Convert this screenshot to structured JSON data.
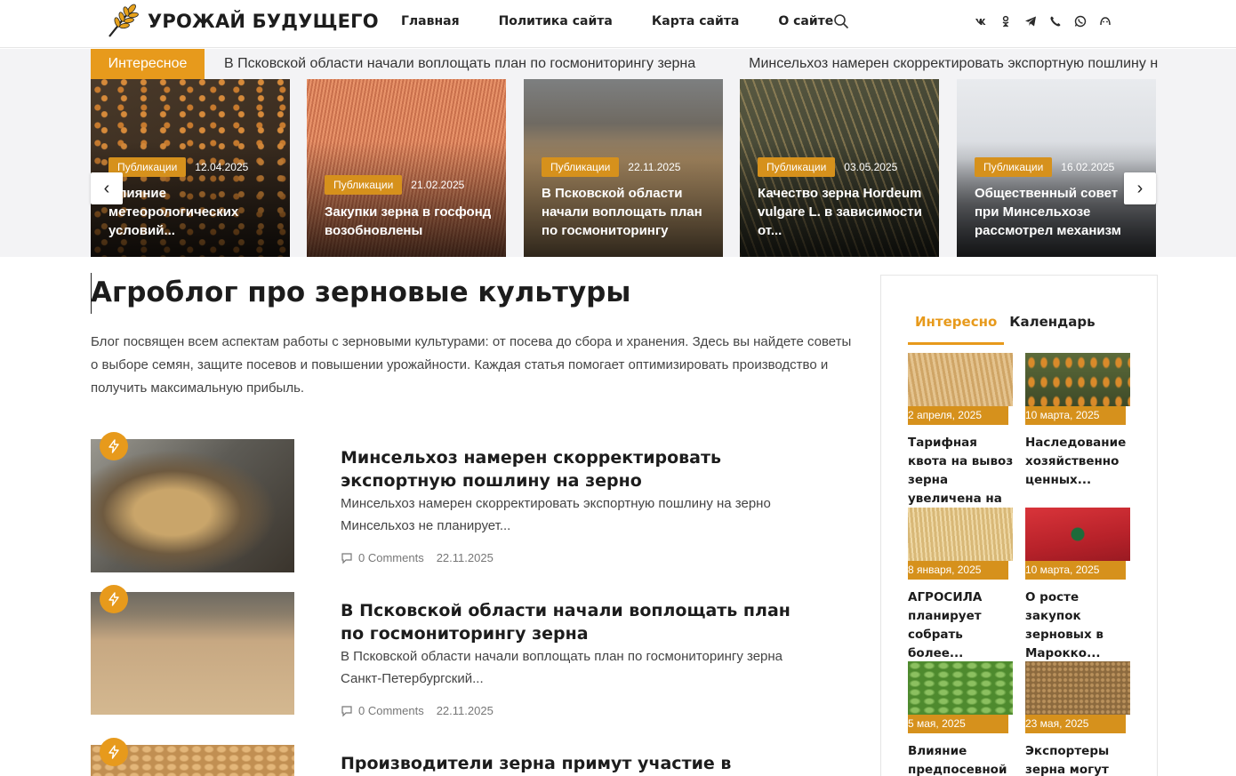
{
  "header": {
    "logo_text": "УРОЖАЙ БУДУЩЕГО",
    "nav": [
      "Главная",
      "Политика сайта",
      "Карта сайта",
      "О сайте"
    ],
    "socials": [
      "vk-icon",
      "odnoklassniki-icon",
      "telegram-icon",
      "viber-icon",
      "whatsapp-icon",
      "max-icon"
    ]
  },
  "ticker": {
    "label": "Интересное",
    "items": [
      "В Псковской области начали воплощать план по госмониторингу зерна",
      "Минсельхоз намерен скорректировать экспортную пошлину на зерно"
    ]
  },
  "featured": [
    {
      "category": "Публикации",
      "date": "12.04.2025",
      "title": "Влияние метеорологических условий..."
    },
    {
      "category": "Публикации",
      "date": "21.02.2025",
      "title": "Закупки зерна в госфонд возобновлены"
    },
    {
      "category": "Публикации",
      "date": "22.11.2025",
      "title": "В Псковской области начали воплощать план по госмониторингу"
    },
    {
      "category": "Публикации",
      "date": "03.05.2025",
      "title": "Качество зерна Hordeum vulgare L. в зависимости от..."
    },
    {
      "category": "Публикации",
      "date": "16.02.2025",
      "title": "Общественный совет при Минсельхозе рассмотрел механизм"
    }
  ],
  "carousel": {
    "prev": "‹",
    "next": "›"
  },
  "main": {
    "title": "Агроблог про зерновые культуры",
    "intro": "Блог посвящен всем аспектам работы с зерновыми культурами: от посева до сбора и хранения. Здесь вы найдете советы о выборе семян, защите посевов и повышении урожайности. Каждая статья помогает оптимизировать производство и получить максимальную прибыль."
  },
  "posts": [
    {
      "title": "Минсельхоз намерен скорректировать экспортную пошлину на зерно",
      "excerpt": "Минсельхоз намерен скорректировать экспортную пошлину на зерно Минсельхоз не планирует...",
      "comments": "0 Comments",
      "date": "22.11.2025"
    },
    {
      "title": "В Псковской области начали воплощать план по госмониторингу зерна",
      "excerpt": "В Псковской области начали воплощать план по госмониторингу зерна Санкт-Петербургский...",
      "comments": "0 Comments",
      "date": "22.11.2025"
    },
    {
      "title": "Производители зерна примут участие в",
      "excerpt": "",
      "comments": "",
      "date": ""
    }
  ],
  "sidebar": {
    "tabs": [
      "Интересно",
      "Календарь"
    ],
    "items": [
      {
        "date": "2 апреля, 2025",
        "title": "Тарифная квота на вывоз зерна увеличена на ..."
      },
      {
        "date": "10 марта, 2025",
        "title": "Наследование хозяйственно ценных..."
      },
      {
        "date": "8 января, 2025",
        "title": "АГРОСИЛА планирует собрать более..."
      },
      {
        "date": "10 марта, 2025",
        "title": "О росте закупок зерновых в Марокко..."
      },
      {
        "date": "5 мая, 2025",
        "title": "Влияние предпосевной"
      },
      {
        "date": "23 мая, 2025",
        "title": "Экспортеры зерна могут"
      }
    ]
  },
  "colors": {
    "accent": "#e79a1c",
    "badge": "#d6911c"
  }
}
